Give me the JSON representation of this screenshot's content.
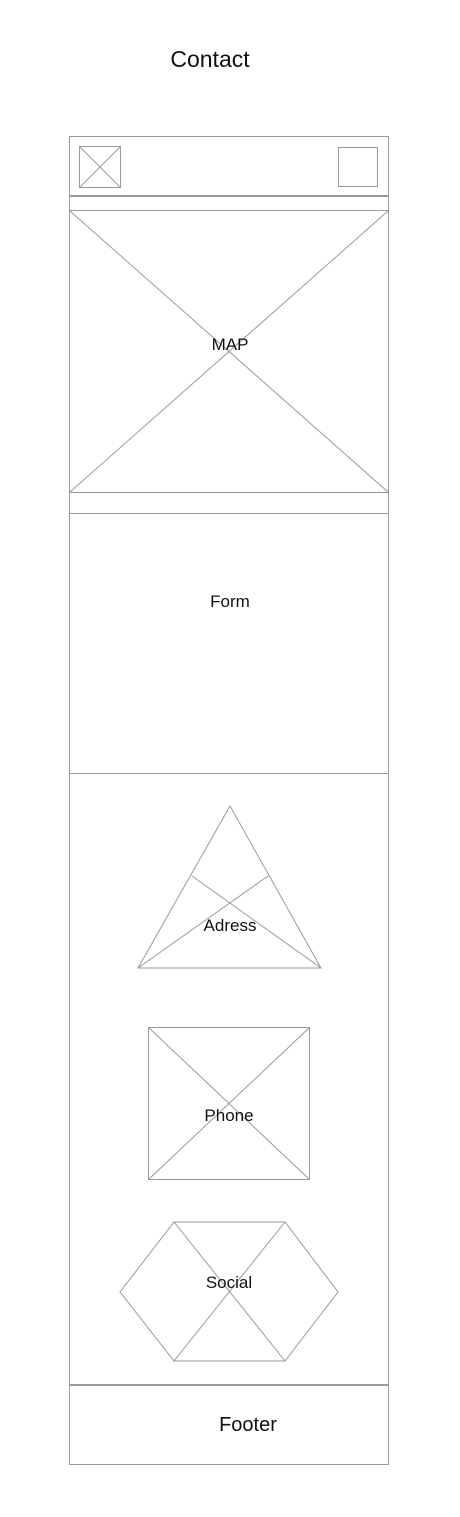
{
  "page": {
    "title": "Contact"
  },
  "header": {
    "logo_icon": "image-placeholder-icon",
    "menu_icon": "square-placeholder-icon"
  },
  "map": {
    "label": "MAP"
  },
  "form": {
    "label": "Form"
  },
  "contact_info": {
    "address_label": "Adress",
    "phone_label": "Phone",
    "social_label": "Social"
  },
  "footer": {
    "label": "Footer"
  },
  "colors": {
    "outline": "#9a9a9a",
    "text": "#111111",
    "background": "#ffffff"
  }
}
